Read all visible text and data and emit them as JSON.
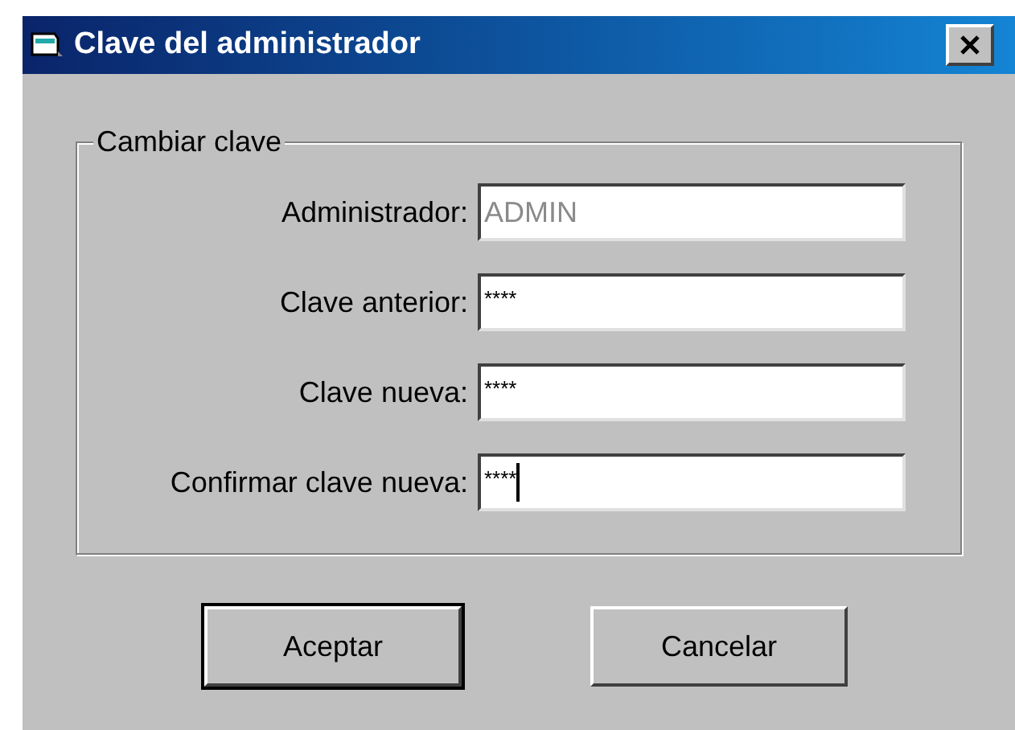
{
  "window": {
    "title": "Clave del administrador"
  },
  "group": {
    "title": "Cambiar clave",
    "fields": [
      {
        "label": "Administrador:",
        "value": "ADMIN",
        "disabled": true,
        "focused": false
      },
      {
        "label": "Clave anterior:",
        "value": "****",
        "disabled": false,
        "focused": false
      },
      {
        "label": "Clave nueva:",
        "value": "****",
        "disabled": false,
        "focused": false
      },
      {
        "label": "Confirmar clave nueva:",
        "value": "****",
        "disabled": false,
        "focused": true
      }
    ]
  },
  "buttons": [
    {
      "label": "Aceptar",
      "default": true
    },
    {
      "label": "Cancelar",
      "default": false
    }
  ]
}
